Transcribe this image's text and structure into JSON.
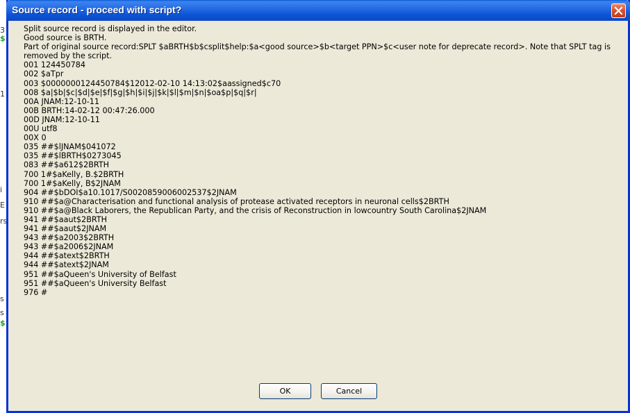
{
  "window": {
    "title": "Source record - proceed with script?"
  },
  "message": {
    "lines": [
      "Split source record is displayed in the editor.",
      "Good source is BRTH.",
      "Part of original source record:SPLT $aBRTH$b$csplit$help:$a<good source>$b<target PPN>$c<user note for deprecate record>. Note that SPLT tag is removed by the script.",
      "001 124450784",
      "002 $aTpr",
      "003 $0000000124450784$12012-02-10 14:13:02$aassigned$c70",
      "008 $a|$b|$c|$d|$e|$f|$g|$h|$i|$j|$k|$l|$m|$n|$oa$p|$q|$r|",
      "00A JNAM:12-10-11",
      "00B BRTH:14-02-12 00:47:26.000",
      "00D JNAM:12-10-11",
      "00U utf8",
      "00X 0",
      "035 ##$lJNAM$041072",
      "035 ##$lBRTH$0273045",
      "083 ##$a612$2BRTH",
      "700 1#$aKelly, B.$2BRTH",
      "700 1#$aKelly, B$2JNAM",
      "904 ##$bDOI$a10.1017/S0020859006002537$2JNAM",
      "910 ##$a@Characterisation and functional analysis of protease activated receptors in neuronal cells$2BRTH",
      "910 ##$a@Black Laborers, the Republican Party, and the crisis of Reconstruction in lowcountry South Carolina$2JNAM",
      "941 ##$aaut$2BRTH",
      "941 ##$aaut$2JNAM",
      "943 ##$a2003$2BRTH",
      "943 ##$a2006$2JNAM",
      "944 ##$atext$2BRTH",
      "944 ##$atext$2JNAM",
      "951 ##$aQueen's University of Belfast",
      "951 ##$aQueen's University Belfast",
      "976 #"
    ]
  },
  "buttons": {
    "ok": "OK",
    "cancel": "Cancel"
  },
  "background": {
    "glyphs": [
      "3",
      "$",
      "1",
      "i",
      "E",
      "rs",
      "s",
      "s",
      "$"
    ]
  },
  "colors": {
    "title_bar": "#0a5bd8",
    "dialog_bg": "#ece9d8",
    "close_button": "#d4502e"
  }
}
